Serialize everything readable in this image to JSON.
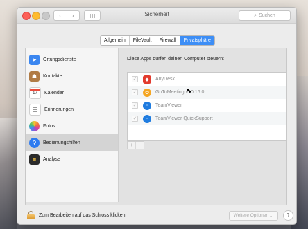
{
  "window": {
    "title": "Sicherheit",
    "search_placeholder": "Suchen",
    "nav_back": "‹",
    "nav_forward": "›"
  },
  "tabs": [
    {
      "label": "Allgemein",
      "active": false
    },
    {
      "label": "FileVault",
      "active": false
    },
    {
      "label": "Firewall",
      "active": false
    },
    {
      "label": "Privatsphäre",
      "active": true
    }
  ],
  "sidebar": {
    "items": [
      {
        "label": "Ortungsdienste",
        "icon": "location-arrow-icon",
        "color": "#3a86f0",
        "selected": false
      },
      {
        "label": "Kontakte",
        "icon": "contacts-book-icon",
        "color": "#b07b45",
        "selected": false
      },
      {
        "label": "Kalender",
        "icon": "calendar-icon",
        "day": "17",
        "selected": false
      },
      {
        "label": "Erinnerungen",
        "icon": "reminders-list-icon",
        "selected": false
      },
      {
        "label": "Fotos",
        "icon": "photos-flower-icon",
        "selected": false
      },
      {
        "label": "Bedienungshilfen",
        "icon": "accessibility-icon",
        "color": "#2e7bf0",
        "selected": true
      },
      {
        "label": "Analyse",
        "icon": "analytics-icon",
        "color": "#2a2a2a",
        "selected": false
      }
    ]
  },
  "content": {
    "heading": "Diese Apps dürfen deinen Computer steuern:",
    "apps": [
      {
        "label": "AnyDesk",
        "checked": true,
        "color": "#e23b2e"
      },
      {
        "label": "GoToMeeting v10.16.0",
        "checked": true,
        "color": "#f5a623"
      },
      {
        "label": "TeamViewer",
        "checked": true,
        "color": "#1f7ce0"
      },
      {
        "label": "TeamViewer QuickSupport",
        "checked": true,
        "color": "#1f7ce0"
      }
    ],
    "add_label": "+",
    "remove_label": "−"
  },
  "footer": {
    "lock_text": "Zum Bearbeiten auf das Schloss klicken.",
    "options_label": "Weitere Optionen ...",
    "help_label": "?"
  }
}
